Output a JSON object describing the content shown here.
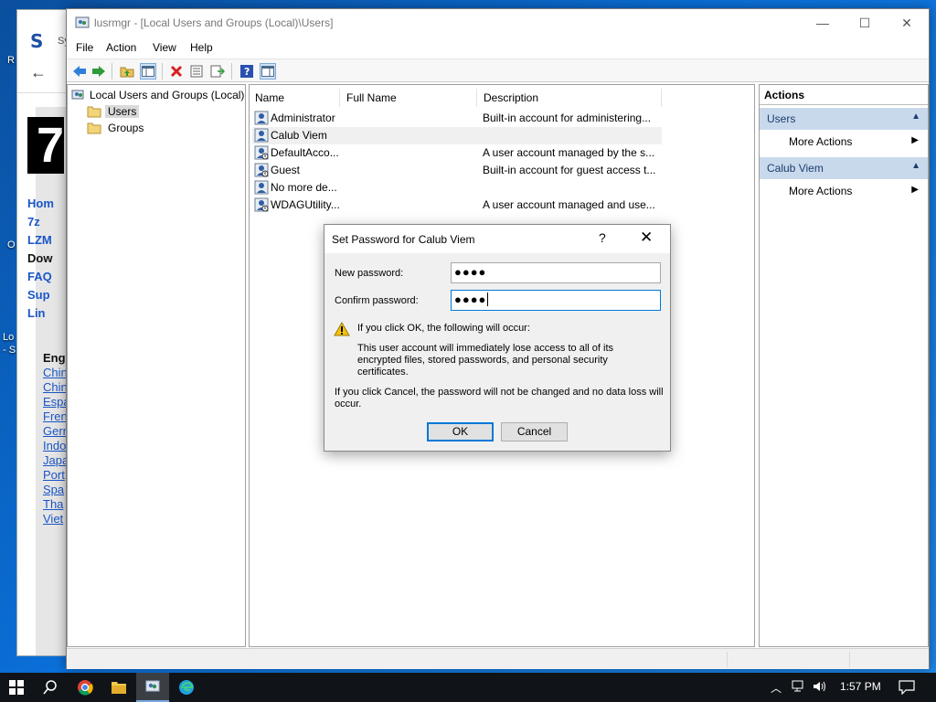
{
  "desktop": {
    "icon_labels": [
      "R",
      "O",
      "Lo",
      "- S"
    ]
  },
  "bg_browser": {
    "logo": "S",
    "tab_fragment": "Sy",
    "hero_glyph": "7",
    "nav_links": [
      "Hom",
      "7z",
      "LZM",
      "Dow",
      "FAQ",
      "Sup",
      "Lin"
    ],
    "lang_heading": "Eng",
    "lang_links": [
      "Chin",
      "Chin",
      "Espa",
      "Fren",
      "Gern",
      "Indo",
      "Japa",
      "Port",
      "Spa",
      "Tha",
      "Viet"
    ]
  },
  "window": {
    "title": "lusrmgr - [Local Users and Groups (Local)\\Users]",
    "menu": [
      "File",
      "Action",
      "View",
      "Help"
    ]
  },
  "tree": {
    "root": "Local Users and Groups (Local)",
    "items": [
      "Users",
      "Groups"
    ],
    "selected": "Users"
  },
  "list": {
    "columns": [
      "Name",
      "Full Name",
      "Description"
    ],
    "rows": [
      {
        "name": "Administrator",
        "full_name": "",
        "description": "Built-in account for administering..."
      },
      {
        "name": "Calub Viem",
        "full_name": "",
        "description": ""
      },
      {
        "name": "DefaultAcco...",
        "full_name": "",
        "description": "A user account managed by the s..."
      },
      {
        "name": "Guest",
        "full_name": "",
        "description": "Built-in account for guest access t..."
      },
      {
        "name": "No more de...",
        "full_name": "",
        "description": ""
      },
      {
        "name": "WDAGUtility...",
        "full_name": "",
        "description": "A user account managed and use..."
      }
    ],
    "selected_row": "Calub Viem"
  },
  "actions": {
    "header": "Actions",
    "sections": [
      {
        "title": "Users",
        "item": "More Actions"
      },
      {
        "title": "Calub Viem",
        "item": "More Actions"
      }
    ]
  },
  "dialog": {
    "title": "Set Password for Calub Viem",
    "help_glyph": "?",
    "close_glyph": "✕",
    "new_password_label": "New password:",
    "new_password_value": "●●●●",
    "confirm_password_label": "Confirm password:",
    "confirm_password_value": "●●●●",
    "warning_heading": "If you click OK, the following will occur:",
    "warning_body": "This user account will immediately lose access to all of its encrypted files, stored passwords, and personal security certificates.",
    "cancel_note": "If you click Cancel, the password will not be changed and no data loss will occur.",
    "ok_label": "OK",
    "cancel_label": "Cancel"
  },
  "taskbar": {
    "time": "1:57 PM"
  },
  "colors": {
    "selection": "#cce8ff",
    "action_section": "#c9d9ec",
    "focus_border": "#0078d7",
    "taskbar": "#101418"
  }
}
